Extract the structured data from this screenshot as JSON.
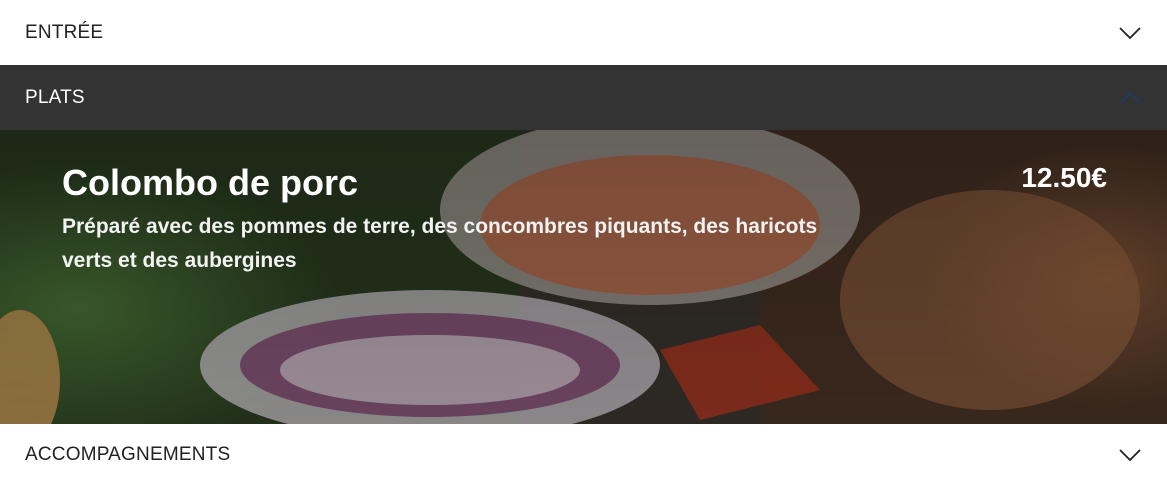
{
  "sections": [
    {
      "title": "ENTRÉE",
      "expanded": false,
      "icon": "chevron-down-icon"
    },
    {
      "title": "PLATS",
      "expanded": true,
      "icon": "chevron-up-icon"
    },
    {
      "title": "ACCOMPAGNEMENTS",
      "expanded": false,
      "icon": "chevron-down-icon"
    }
  ],
  "dish": {
    "name": "Colombo de porc",
    "description": "Préparé avec des pommes de terre, des concombres piquants, des haricots verts et des aubergines",
    "price": "12.50€"
  },
  "colors": {
    "header_dark": "#333333",
    "header_light": "#ffffff",
    "active_chevron": "#1f3b66"
  }
}
